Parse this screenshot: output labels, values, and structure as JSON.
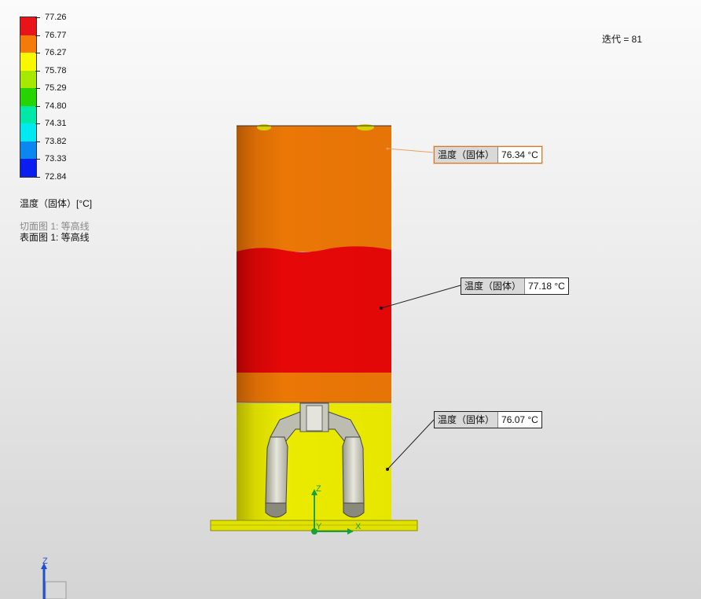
{
  "legend": {
    "colors": [
      "#e8141a",
      "#f47a0a",
      "#f8f800",
      "#a6e800",
      "#26d400",
      "#00e8a8",
      "#00e8f0",
      "#0a88f0",
      "#0a1ef0"
    ],
    "labels": [
      "77.26",
      "76.77",
      "76.27",
      "75.78",
      "75.29",
      "74.80",
      "74.31",
      "73.82",
      "73.33",
      "72.84"
    ],
    "title": "温度（固体）[°C]"
  },
  "plots": {
    "section": "切面图 1: 等高线",
    "surface": "表面图 1: 等高线"
  },
  "iteration": "迭代 = 81",
  "probes": [
    {
      "label": "温度（固体）",
      "value": "76.34 °C",
      "selected": true
    },
    {
      "label": "温度（固体）",
      "value": "77.18 °C",
      "selected": false
    },
    {
      "label": "温度（固体）",
      "value": "76.07 °C",
      "selected": false
    }
  ],
  "axes": {
    "x": "X",
    "y": "Y",
    "z": "Z"
  },
  "colors": {
    "orange": "#e87406",
    "red": "#e40808",
    "yellow": "#e8e800",
    "dark_orange": "#b85a04",
    "triad_green": "#1aa03a",
    "triad_blue": "#2050d0"
  }
}
